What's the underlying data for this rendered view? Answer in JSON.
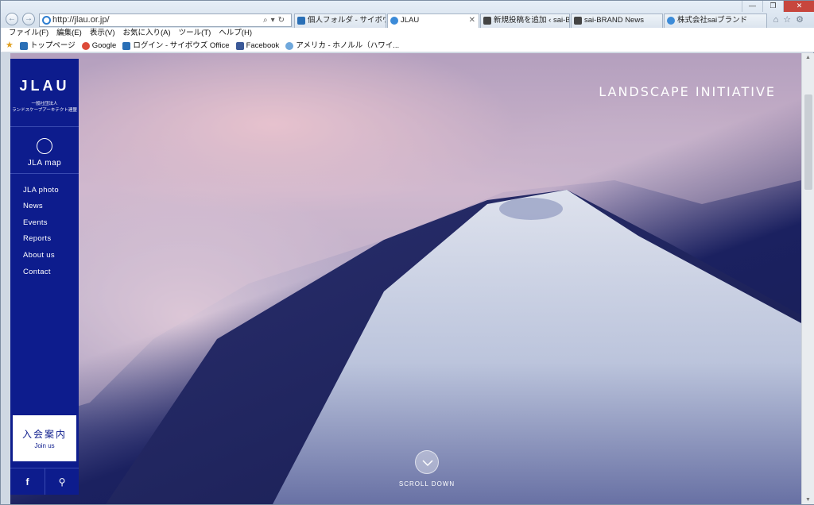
{
  "browser": {
    "url": "http://jlau.or.jp/",
    "tabs": [
      {
        "label": "個人フォルダ - サイボウズ Office",
        "color": "#2a6fb6"
      },
      {
        "label": "JLAU",
        "color": "#3c8bd8",
        "active": true
      },
      {
        "label": "新規投稿を追加 ‹ sai-BRA...",
        "color": "#444444"
      },
      {
        "label": "sai-BRAND News",
        "color": "#444444"
      },
      {
        "label": "株式会社saiブランド",
        "color": "#3c8bd8"
      }
    ],
    "menu": [
      "ファイル(F)",
      "編集(E)",
      "表示(V)",
      "お気に入り(A)",
      "ツール(T)",
      "ヘルプ(H)"
    ],
    "favorites": [
      {
        "label": "トップページ",
        "color": "#2a6fb6"
      },
      {
        "label": "Google",
        "color": "#dd4b39"
      },
      {
        "label": "ログイン - サイボウズ Office",
        "color": "#2a6fb6"
      },
      {
        "label": "Facebook",
        "color": "#3b5998"
      },
      {
        "label": "アメリカ - ホノルル（ハワイ...",
        "color": "#6fa8dc"
      }
    ]
  },
  "site": {
    "logo": "JLAU",
    "logo_sub1": "一般社団法人",
    "logo_sub2": "ランドスケープアーキテクト連盟",
    "map_label": "JLA map",
    "nav": [
      "JLA photo",
      "News",
      "Events",
      "Reports",
      "About us",
      "Contact"
    ],
    "join_jp": "入会案内",
    "join_en": "Join us",
    "social_facebook": "f",
    "search_glyph": "⚲",
    "tagline": "LANDSCAPE INITIATIVE",
    "scroll_label": "SCROLL DOWN",
    "brand_color": "#0d1c8d"
  }
}
